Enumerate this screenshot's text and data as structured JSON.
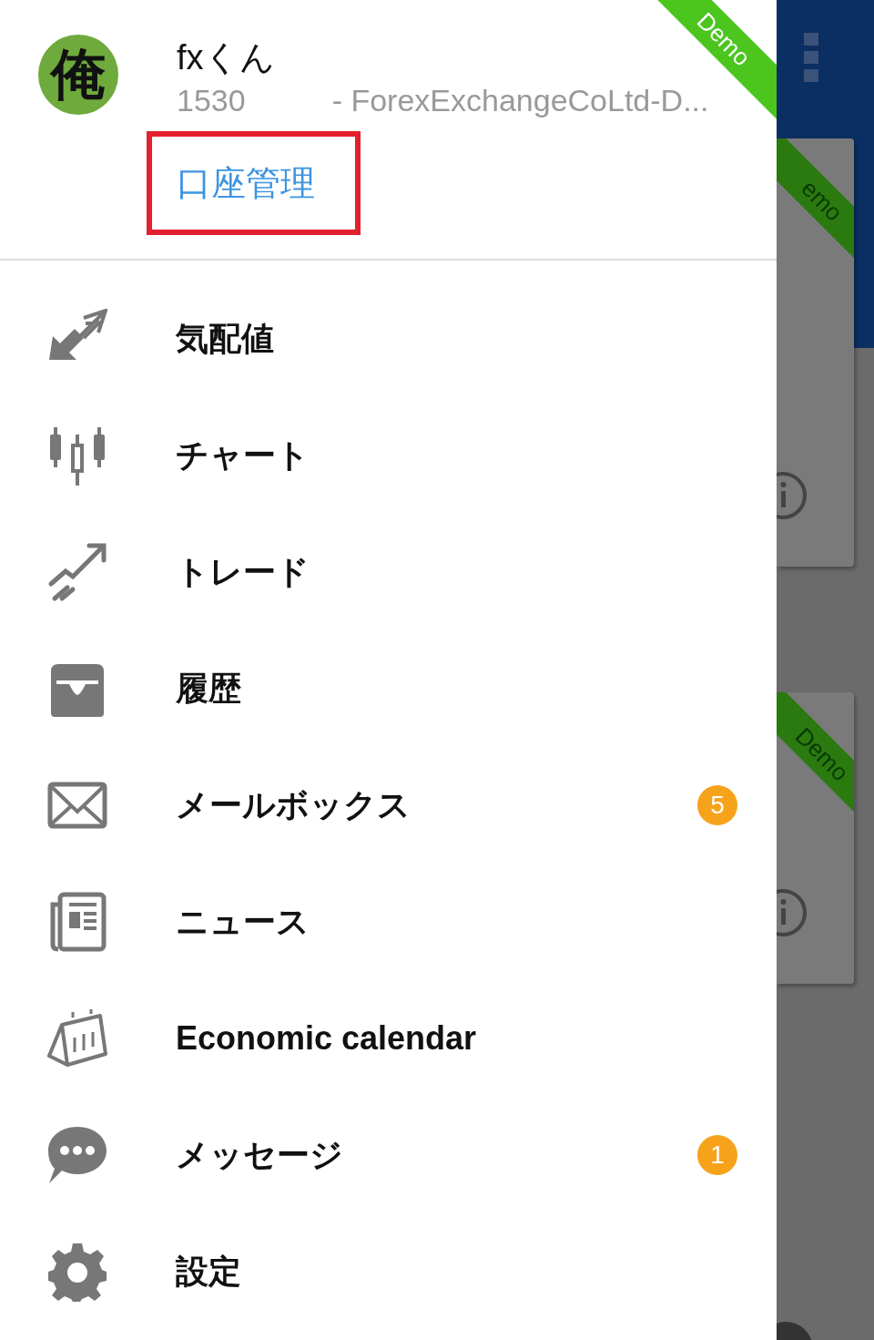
{
  "drawer": {
    "ribbon": "Demo",
    "avatar": "俺",
    "user_name": "fxくん",
    "account_number": "1530",
    "server": "- ForexExchangeCoLtd-D...",
    "account_link": {
      "label": "口座管理",
      "highlighted": true
    },
    "menu": [
      {
        "kind": "quotes",
        "label": "気配値"
      },
      {
        "kind": "chart",
        "label": "チャート"
      },
      {
        "kind": "trade",
        "label": "トレード"
      },
      {
        "kind": "history",
        "label": "履歴"
      },
      {
        "kind": "mail",
        "label": "メールボックス",
        "badge": "5"
      },
      {
        "kind": "news",
        "label": "ニュース"
      },
      {
        "kind": "calendar",
        "label": "Economic calendar"
      },
      {
        "kind": "chat",
        "label": "メッセージ",
        "badge": "1"
      },
      {
        "kind": "gear",
        "label": "設定"
      }
    ]
  },
  "background": {
    "cards": [
      {
        "ribbon": "emo"
      },
      {
        "ribbon": "Demo"
      }
    ]
  }
}
